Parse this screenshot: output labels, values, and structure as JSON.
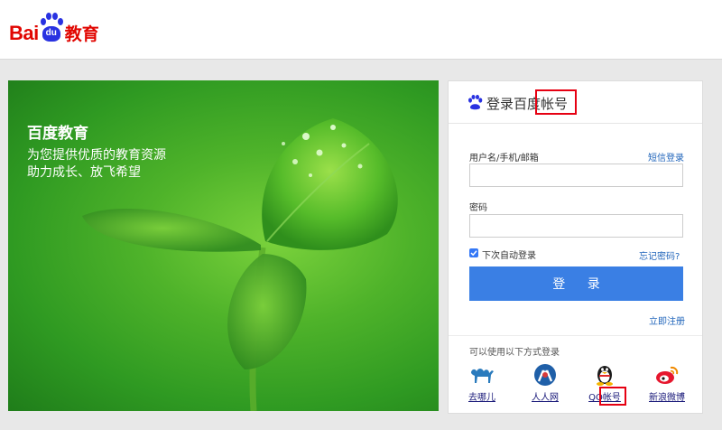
{
  "header": {
    "logo_text_bai": "Bai",
    "logo_text_du": "du",
    "logo_text_edu": "教育"
  },
  "hero": {
    "title": "百度教育",
    "line1": "为您提供优质的教育资源",
    "line2": "助力成长、放飞希望"
  },
  "login": {
    "title": "登录百度帐号",
    "username_label": "用户名/手机/邮箱",
    "sms_login": "短信登录",
    "username_value": "",
    "password_label": "密码",
    "password_value": "",
    "remember_label": "下次自动登录",
    "remember_checked": true,
    "forgot": "忘记密码?",
    "submit": "登 录",
    "register": "立即注册",
    "other_methods": "可以使用以下方式登录",
    "providers": [
      {
        "name": "去哪儿",
        "icon": "camel-icon"
      },
      {
        "name": "人人网",
        "icon": "renren-icon"
      },
      {
        "name": "QQ帐号",
        "icon": "qq-penguin-icon"
      },
      {
        "name": "新浪微博",
        "icon": "weibo-icon"
      }
    ]
  },
  "colors": {
    "brand_red": "#e10601",
    "brand_blue": "#2932e1",
    "button_blue": "#3a7fe4",
    "highlight_red": "#e60012"
  }
}
